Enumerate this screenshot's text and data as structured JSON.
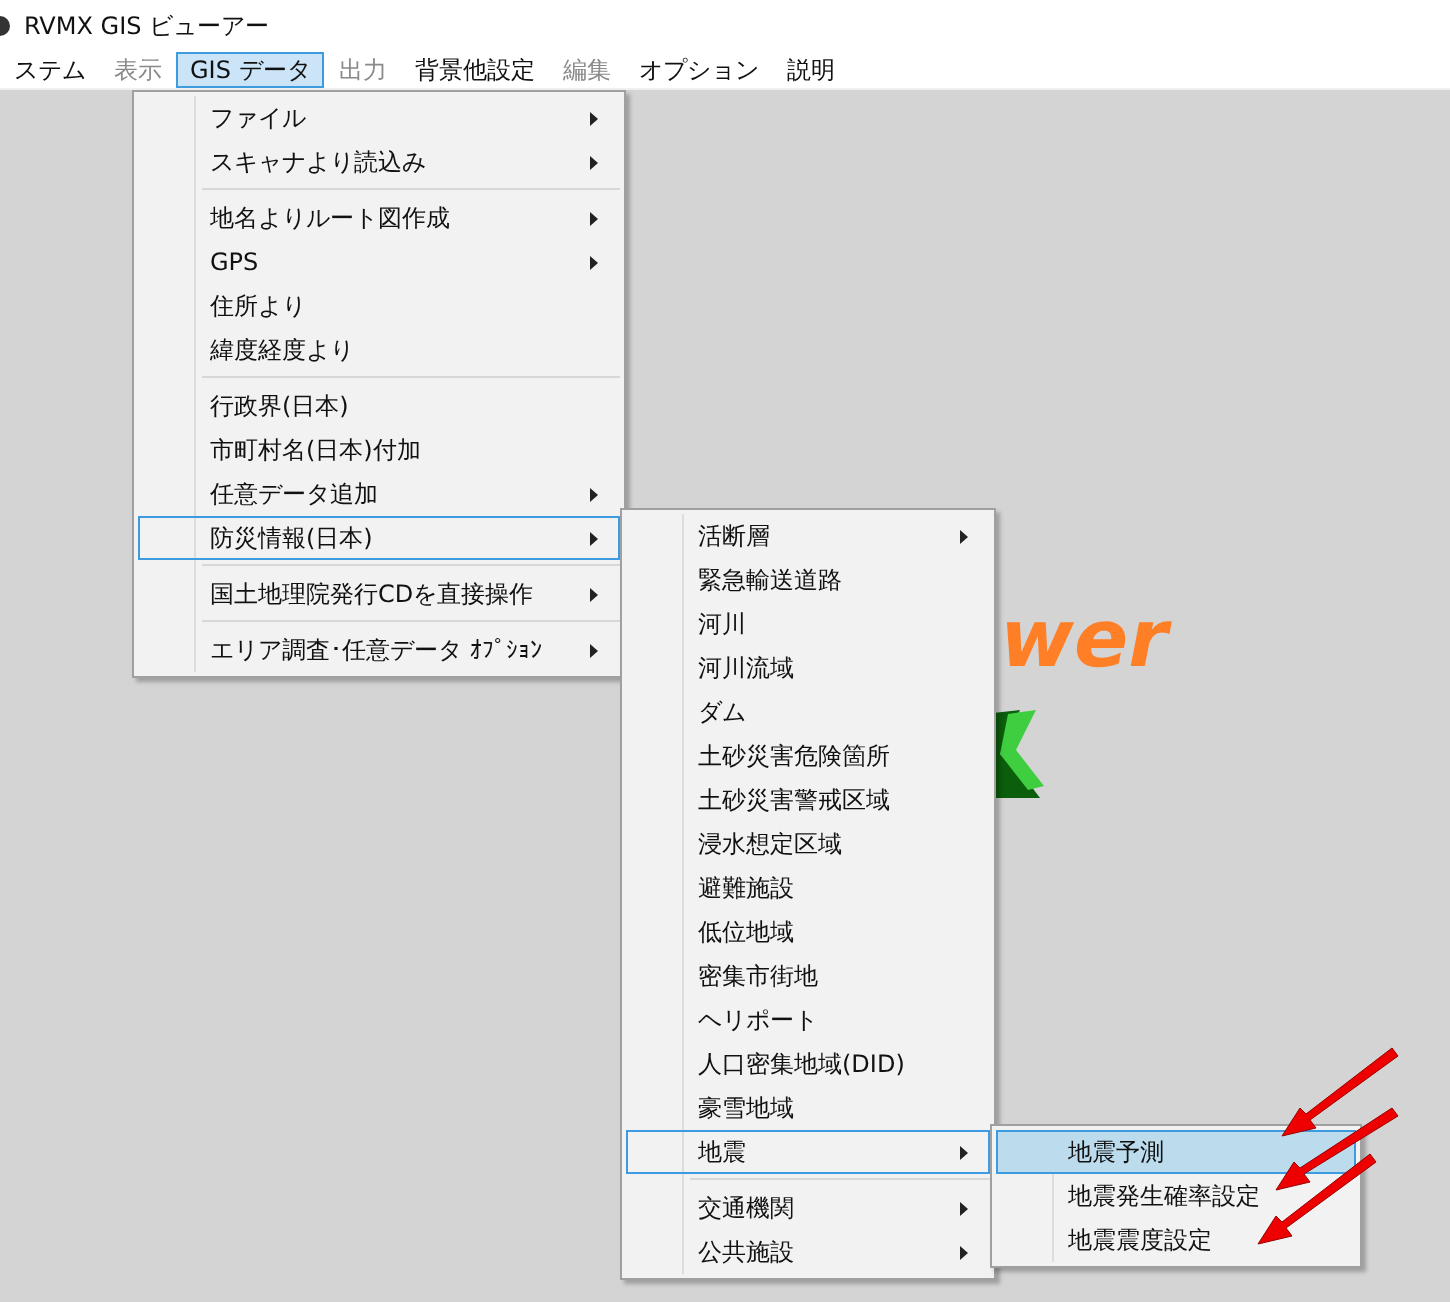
{
  "window": {
    "title": "RVMX GIS ビューアー"
  },
  "menubar": [
    {
      "label": "ステム",
      "disabled": false,
      "selected": false
    },
    {
      "label": "表示",
      "disabled": true,
      "selected": false
    },
    {
      "label": "GIS データ",
      "disabled": false,
      "selected": true
    },
    {
      "label": "出力",
      "disabled": true,
      "selected": false
    },
    {
      "label": "背景他設定",
      "disabled": false,
      "selected": false
    },
    {
      "label": "編集",
      "disabled": true,
      "selected": false
    },
    {
      "label": "オプション",
      "disabled": false,
      "selected": false
    },
    {
      "label": "説明",
      "disabled": false,
      "selected": false
    }
  ],
  "logo": {
    "text": "wer"
  },
  "menus": [
    {
      "focused": false,
      "items": [
        {
          "kind": "item",
          "label": "ファイル",
          "submenu": true,
          "selected": false
        },
        {
          "kind": "item",
          "label": "スキャナより読込み",
          "submenu": true,
          "selected": false
        },
        {
          "kind": "separator"
        },
        {
          "kind": "item",
          "label": "地名よりルート図作成",
          "submenu": true,
          "selected": false
        },
        {
          "kind": "item",
          "label": "GPS",
          "submenu": true,
          "selected": false
        },
        {
          "kind": "item",
          "label": "住所より",
          "submenu": false,
          "selected": false
        },
        {
          "kind": "item",
          "label": "緯度経度より",
          "submenu": false,
          "selected": false
        },
        {
          "kind": "separator"
        },
        {
          "kind": "item",
          "label": "行政界(日本)",
          "submenu": false,
          "selected": false
        },
        {
          "kind": "item",
          "label": "市町村名(日本)付加",
          "submenu": false,
          "selected": false
        },
        {
          "kind": "item",
          "label": "任意データ追加",
          "submenu": true,
          "selected": false
        },
        {
          "kind": "item",
          "label": "防災情報(日本)",
          "submenu": true,
          "selected": true
        },
        {
          "kind": "separator"
        },
        {
          "kind": "item",
          "label": "国土地理院発行CDを直接操作",
          "submenu": true,
          "selected": false
        },
        {
          "kind": "separator"
        },
        {
          "kind": "item",
          "label": "エリア調査･任意データ ｵﾌﾟｼｮﾝ",
          "submenu": true,
          "selected": false
        }
      ]
    },
    {
      "focused": false,
      "items": [
        {
          "kind": "item",
          "label": "活断層",
          "submenu": true,
          "selected": false
        },
        {
          "kind": "item",
          "label": "緊急輸送道路",
          "submenu": false,
          "selected": false
        },
        {
          "kind": "item",
          "label": "河川",
          "submenu": false,
          "selected": false
        },
        {
          "kind": "item",
          "label": "河川流域",
          "submenu": false,
          "selected": false
        },
        {
          "kind": "item",
          "label": "ダム",
          "submenu": false,
          "selected": false
        },
        {
          "kind": "item",
          "label": "土砂災害危険箇所",
          "submenu": false,
          "selected": false
        },
        {
          "kind": "item",
          "label": "土砂災害警戒区域",
          "submenu": false,
          "selected": false
        },
        {
          "kind": "item",
          "label": "浸水想定区域",
          "submenu": false,
          "selected": false
        },
        {
          "kind": "item",
          "label": "避難施設",
          "submenu": false,
          "selected": false
        },
        {
          "kind": "item",
          "label": "低位地域",
          "submenu": false,
          "selected": false
        },
        {
          "kind": "item",
          "label": "密集市街地",
          "submenu": false,
          "selected": false
        },
        {
          "kind": "item",
          "label": "ヘリポート",
          "submenu": false,
          "selected": false
        },
        {
          "kind": "item",
          "label": "人口密集地域(DID)",
          "submenu": false,
          "selected": false
        },
        {
          "kind": "item",
          "label": "豪雪地域",
          "submenu": false,
          "selected": false
        },
        {
          "kind": "item",
          "label": "地震",
          "submenu": true,
          "selected": true
        },
        {
          "kind": "separator"
        },
        {
          "kind": "item",
          "label": "交通機関",
          "submenu": true,
          "selected": false
        },
        {
          "kind": "item",
          "label": "公共施設",
          "submenu": true,
          "selected": false
        }
      ]
    },
    {
      "focused": true,
      "items": [
        {
          "kind": "item",
          "label": "地震予測",
          "submenu": false,
          "selected": true
        },
        {
          "kind": "item",
          "label": "地震発生確率設定",
          "submenu": false,
          "selected": false
        },
        {
          "kind": "item",
          "label": "地震震度設定",
          "submenu": false,
          "selected": false
        }
      ]
    }
  ]
}
